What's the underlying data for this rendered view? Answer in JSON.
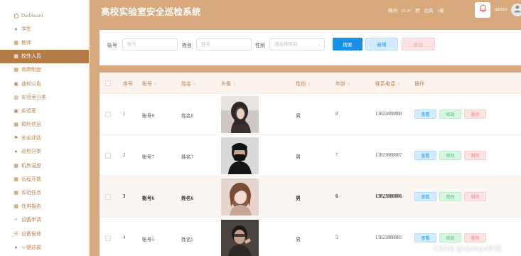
{
  "sidebar": {
    "items": [
      {
        "label": "Dashboard",
        "icon": "home-icon"
      },
      {
        "label": "学生",
        "icon": "location-icon"
      },
      {
        "label": "教师",
        "icon": "grid-icon"
      },
      {
        "label": "校外人员",
        "icon": "grid-icon",
        "active": true
      },
      {
        "label": "观摩制度",
        "icon": "grid-icon"
      },
      {
        "label": "通知公告",
        "icon": "briefcase-icon"
      },
      {
        "label": "实验室分类",
        "icon": "bar-chart-icon"
      },
      {
        "label": "实验室",
        "icon": "check-square-icon"
      },
      {
        "label": "预约信息",
        "icon": "grid-icon"
      },
      {
        "label": "安全评估",
        "icon": "flag-icon"
      },
      {
        "label": "巡检分类",
        "icon": "user-icon"
      },
      {
        "label": "机房温度",
        "icon": "grid-icon"
      },
      {
        "label": "远程开锁",
        "icon": "grid-icon"
      },
      {
        "label": "实验任务",
        "icon": "grid-icon"
      },
      {
        "label": "任务报告",
        "icon": "grid-icon"
      },
      {
        "label": "设备申请",
        "icon": "sliders-icon"
      },
      {
        "label": "设备报修",
        "icon": "list-icon"
      },
      {
        "label": "一键巡视",
        "icon": "user-icon"
      }
    ]
  },
  "header": {
    "title": "高校实验室安全巡检系统",
    "city": "梅州",
    "temperature": "21.4°",
    "weather": "阴",
    "wind": "北风",
    "wind_level": "1级",
    "username": "admin"
  },
  "search": {
    "account_label": "账号",
    "account_placeholder": "账号",
    "name_label": "姓名",
    "name_placeholder": "姓名",
    "gender_label": "性别",
    "gender_placeholder": "请选择性别",
    "search_button": "搜索",
    "add_button": "新增",
    "delete_button": "删除"
  },
  "table": {
    "columns": {
      "seq": "序号",
      "account": "账号",
      "name": "姓名",
      "avatar": "头像",
      "gender": "性别",
      "age": "年龄",
      "phone": "联系电话",
      "actions": "操作"
    },
    "action_labels": {
      "view": "查看",
      "edit": "修改",
      "delete": "删除"
    },
    "rows": [
      {
        "seq": "1",
        "account": "账号8",
        "name": "姓名8",
        "gender": "男",
        "age": "8",
        "phone": "13823888888"
      },
      {
        "seq": "2",
        "account": "账号7",
        "name": "姓名7",
        "gender": "男",
        "age": "7",
        "phone": "13823888887"
      },
      {
        "seq": "3",
        "account": "账号6",
        "name": "姓名6",
        "gender": "男",
        "age": "6",
        "phone": "13823888886"
      },
      {
        "seq": "4",
        "account": "账号5",
        "name": "姓名5",
        "gender": "男",
        "age": "5",
        "phone": "13823888885"
      }
    ]
  },
  "watermark": "CSDN @django毕设",
  "colors": {
    "accent": "#d8a97c",
    "active_item": "#b67c48",
    "primary": "#1890e4"
  }
}
